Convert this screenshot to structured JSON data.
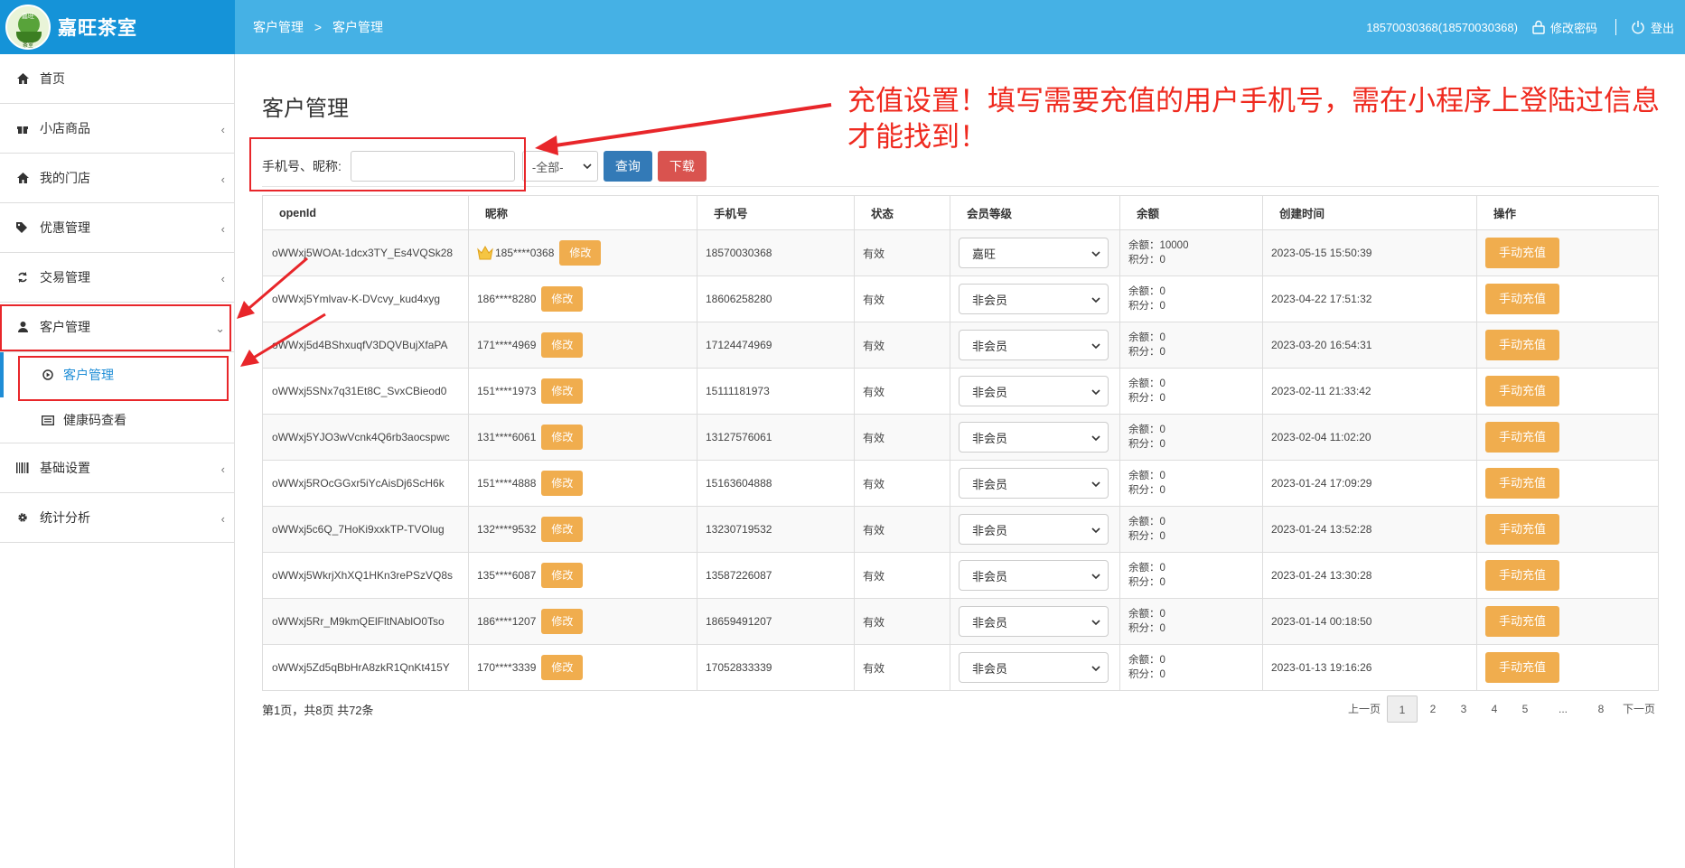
{
  "brand": {
    "logo_top": "嘉旺",
    "logo_bottom": "茶室",
    "name": "嘉旺茶室"
  },
  "breadcrumb": [
    "客户管理",
    ">",
    "客户管理"
  ],
  "header": {
    "account": "18570030368(18570030368)",
    "change_password": "修改密码",
    "logout": "登出"
  },
  "sidebar": {
    "items": [
      {
        "label": "首页",
        "icon": "home-icon"
      },
      {
        "label": "小店商品",
        "icon": "gift-icon"
      },
      {
        "label": "我的门店",
        "icon": "home-icon"
      },
      {
        "label": "优惠管理",
        "icon": "tags-icon"
      },
      {
        "label": "交易管理",
        "icon": "refresh-icon"
      },
      {
        "label": "客户管理",
        "icon": "user-icon"
      },
      {
        "label": "基础设置",
        "icon": "barcode-icon"
      },
      {
        "label": "统计分析",
        "icon": "gear-icon"
      }
    ],
    "sub_items": [
      {
        "label": "客户管理",
        "icon": "play-circle-icon"
      },
      {
        "label": "健康码查看",
        "icon": "card-icon"
      }
    ]
  },
  "main": {
    "title": "客户管理",
    "search": {
      "label": "手机号、昵称:",
      "value": "",
      "filter": "-全部-",
      "query": "查询",
      "download": "下载"
    },
    "columns": [
      "openId",
      "昵称",
      "手机号",
      "状态",
      "会员等级",
      "余额",
      "创建时间",
      "操作"
    ],
    "edit_label": "修改",
    "charge_label": "手动充值",
    "balance_prefix": "余额：",
    "points_prefix": "积分：",
    "rows": [
      {
        "openid": "oWWxj5WOAt-1dcx3TY_Es4VQSk28",
        "nick": "185****0368",
        "crown": true,
        "phone": "18570030368",
        "status": "有效",
        "level": "嘉旺",
        "balance": "10000",
        "points": "0",
        "created": "2023-05-15 15:50:39"
      },
      {
        "openid": "oWWxj5Ymlvav-K-DVcvy_kud4xyg",
        "nick": "186****8280",
        "crown": false,
        "phone": "18606258280",
        "status": "有效",
        "level": "非会员",
        "balance": "0",
        "points": "0",
        "created": "2023-04-22 17:51:32"
      },
      {
        "openid": "oWWxj5d4BShxuqfV3DQVBujXfaPA",
        "nick": "171****4969",
        "crown": false,
        "phone": "17124474969",
        "status": "有效",
        "level": "非会员",
        "balance": "0",
        "points": "0",
        "created": "2023-03-20 16:54:31"
      },
      {
        "openid": "oWWxj5SNx7q31Et8C_SvxCBieod0",
        "nick": "151****1973",
        "crown": false,
        "phone": "15111181973",
        "status": "有效",
        "level": "非会员",
        "balance": "0",
        "points": "0",
        "created": "2023-02-11 21:33:42"
      },
      {
        "openid": "oWWxj5YJO3wVcnk4Q6rb3aocspwc",
        "nick": "131****6061",
        "crown": false,
        "phone": "13127576061",
        "status": "有效",
        "level": "非会员",
        "balance": "0",
        "points": "0",
        "created": "2023-02-04 11:02:20"
      },
      {
        "openid": "oWWxj5ROcGGxr5iYcAisDj6ScH6k",
        "nick": "151****4888",
        "crown": false,
        "phone": "15163604888",
        "status": "有效",
        "level": "非会员",
        "balance": "0",
        "points": "0",
        "created": "2023-01-24 17:09:29"
      },
      {
        "openid": "oWWxj5c6Q_7HoKi9xxkTP-TVOlug",
        "nick": "132****9532",
        "crown": false,
        "phone": "13230719532",
        "status": "有效",
        "level": "非会员",
        "balance": "0",
        "points": "0",
        "created": "2023-01-24 13:52:28"
      },
      {
        "openid": "oWWxj5WkrjXhXQ1HKn3rePSzVQ8s",
        "nick": "135****6087",
        "crown": false,
        "phone": "13587226087",
        "status": "有效",
        "level": "非会员",
        "balance": "0",
        "points": "0",
        "created": "2023-01-24 13:30:28"
      },
      {
        "openid": "oWWxj5Rr_M9kmQElFltNAblO0Tso",
        "nick": "186****1207",
        "crown": false,
        "phone": "18659491207",
        "status": "有效",
        "level": "非会员",
        "balance": "0",
        "points": "0",
        "created": "2023-01-14 00:18:50"
      },
      {
        "openid": "oWWxj5Zd5qBbHrA8zkR1QnKt415Y",
        "nick": "170****3339",
        "crown": false,
        "phone": "17052833339",
        "status": "有效",
        "level": "非会员",
        "balance": "0",
        "points": "0",
        "created": "2023-01-13 19:16:26"
      }
    ],
    "page_info": "第1页，共8页 共72条",
    "pager": [
      "上一页",
      "1",
      "2",
      "3",
      "4",
      "5",
      "...",
      "8",
      "下一页"
    ],
    "pager_active": "1"
  },
  "annotation": {
    "text": "充值设置！填写需要充值的用户手机号，需在小程序上登陆过信息才能找到！",
    "color": "#e8262a"
  }
}
